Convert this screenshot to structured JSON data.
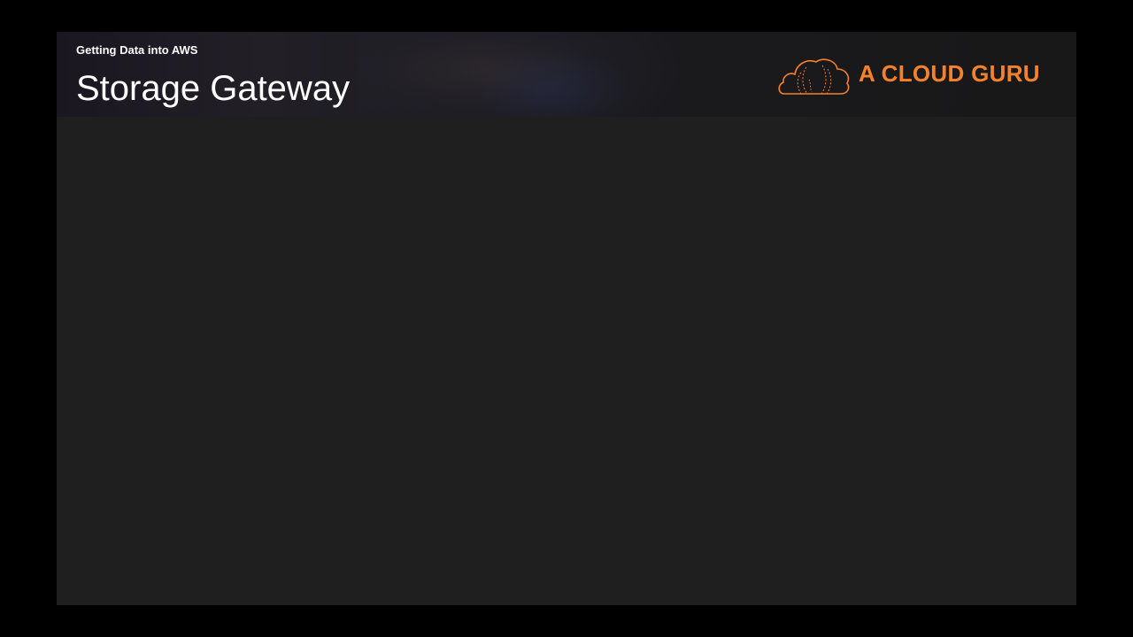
{
  "slide": {
    "subtitle": "Getting Data into AWS",
    "title": "Storage Gateway"
  },
  "logo": {
    "text": "A CLOUD GURU",
    "icon": "cloud-logo-icon",
    "color": "#f5822a"
  },
  "colors": {
    "outer_background": "#000000",
    "slide_background": "#1f1f1f",
    "text": "#ffffff"
  }
}
